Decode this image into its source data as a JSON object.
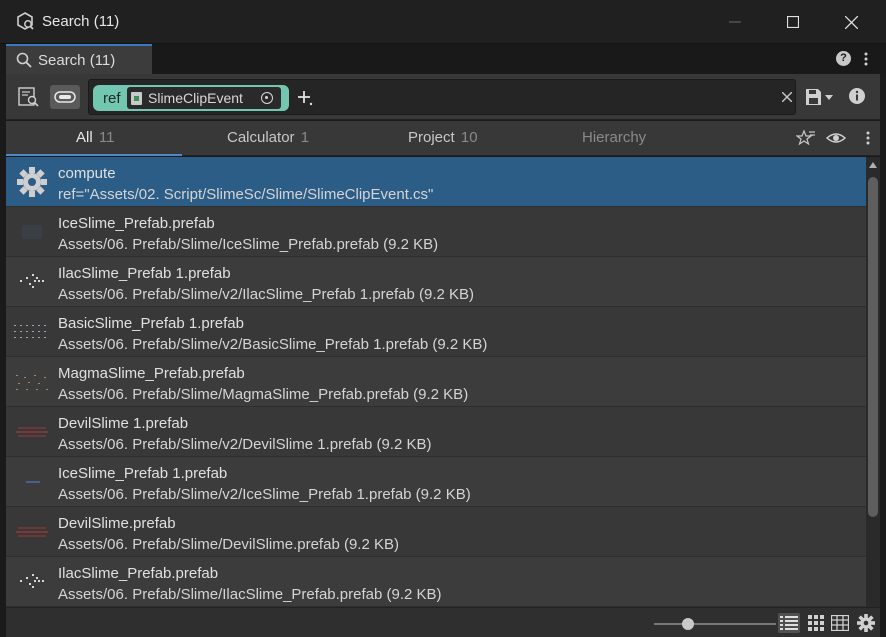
{
  "window": {
    "title": "Search (11)",
    "minimize_icon": "minimize-icon",
    "maximize_icon": "maximize-icon",
    "close_icon": "close-icon"
  },
  "tab": {
    "label": "Search (11)",
    "icon": "search-icon"
  },
  "toolbar": {
    "query_chip": {
      "keyword": "ref",
      "object_label": "SlimeClipEvent"
    },
    "add_filter_icon": "plus-icon",
    "clear_icon": "close-icon",
    "save_icon": "save-icon",
    "info_icon": "info-icon"
  },
  "filters": {
    "tabs": [
      {
        "label": "All",
        "count": "11"
      },
      {
        "label": "Calculator",
        "count": "1"
      },
      {
        "label": "Project",
        "count": "10"
      },
      {
        "label": "Hierarchy",
        "count": ""
      }
    ],
    "selected": "All"
  },
  "results": [
    {
      "title": "compute",
      "subtitle": "ref=\"Assets/02. Script/SlimeSc/Slime/SlimeClipEvent.cs\"",
      "icon": "gear-icon",
      "selected": true
    },
    {
      "title": "IceSlime_Prefab.prefab",
      "subtitle": "Assets/06. Prefab/Slime/IceSlime_Prefab.prefab (9.2 KB)",
      "icon": "prefab-thumbnail-ice"
    },
    {
      "title": "IlacSlime_Prefab 1.prefab",
      "subtitle": "Assets/06. Prefab/Slime/v2/IlacSlime_Prefab 1.prefab (9.2 KB)",
      "icon": "prefab-thumbnail-lilac"
    },
    {
      "title": "BasicSlime_Prefab 1.prefab",
      "subtitle": "Assets/06. Prefab/Slime/v2/BasicSlime_Prefab 1.prefab (9.2 KB)",
      "icon": "prefab-thumbnail-basic"
    },
    {
      "title": "MagmaSlime_Prefab.prefab",
      "subtitle": "Assets/06. Prefab/Slime/MagmaSlime_Prefab.prefab (9.2 KB)",
      "icon": "prefab-thumbnail-magma"
    },
    {
      "title": "DevilSlime 1.prefab",
      "subtitle": "Assets/06. Prefab/Slime/v2/DevilSlime 1.prefab (9.2 KB)",
      "icon": "prefab-thumbnail-devil"
    },
    {
      "title": "IceSlime_Prefab 1.prefab",
      "subtitle": "Assets/06. Prefab/Slime/v2/IceSlime_Prefab 1.prefab (9.2 KB)",
      "icon": "prefab-thumbnail-ice"
    },
    {
      "title": "DevilSlime.prefab",
      "subtitle": "Assets/06. Prefab/Slime/DevilSlime.prefab (9.2 KB)",
      "icon": "prefab-thumbnail-devil"
    },
    {
      "title": "IlacSlime_Prefab.prefab",
      "subtitle": "Assets/06. Prefab/Slime/IlacSlime_Prefab.prefab (9.2 KB)",
      "icon": "prefab-thumbnail-lilac"
    }
  ],
  "status": {
    "zoom_level": 0.3,
    "views": [
      "list-view-icon",
      "grid-view-icon",
      "table-view-icon",
      "settings-icon"
    ]
  },
  "colors": {
    "chip": "#73c6b0",
    "selection": "#2c5d87",
    "accent": "#4d88c4"
  }
}
